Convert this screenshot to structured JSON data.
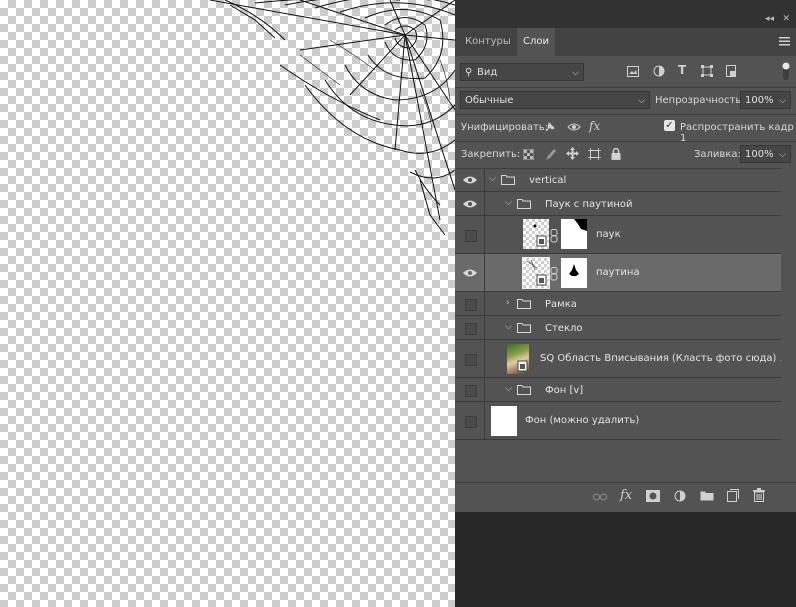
{
  "tabs": [
    {
      "label": "Контуры",
      "active": false
    },
    {
      "label": "Слои",
      "active": true
    }
  ],
  "filter": {
    "kind_label": "Вид"
  },
  "blend": {
    "mode": "Обычные",
    "opacity_label": "Непрозрачность:",
    "opacity_value": "100%"
  },
  "unify": {
    "label": "Унифицировать:",
    "propagate_label": "Распространить кадр 1",
    "propagate_checked": true
  },
  "lock": {
    "label": "Закрепить:",
    "fill_label": "Заливка:",
    "fill_value": "100%"
  },
  "layers": [
    {
      "name": "vertical",
      "type": "group",
      "expanded": true,
      "visible": true,
      "indent": 0
    },
    {
      "name": "Паук с паутиной",
      "type": "group",
      "expanded": true,
      "visible": true,
      "indent": 1
    },
    {
      "name": "паук",
      "type": "smart",
      "visible": false,
      "indent": 2
    },
    {
      "name": "паутина",
      "type": "smart",
      "visible": true,
      "selected": true,
      "indent": 2
    },
    {
      "name": "Рамка",
      "type": "group",
      "expanded": false,
      "visible": false,
      "indent": 1
    },
    {
      "name": "Стекло",
      "type": "group",
      "expanded": true,
      "visible": false,
      "indent": 1
    },
    {
      "name": "SQ Область Вписывания (Класть фото сюда) ...",
      "type": "photo",
      "visible": false,
      "indent": 1
    },
    {
      "name": "Фон [v]",
      "type": "group",
      "expanded": true,
      "visible": false,
      "indent": 1
    },
    {
      "name": "Фон (можно удалить)",
      "type": "fill",
      "visible": false,
      "indent": 0
    }
  ],
  "colors": {
    "panel": "#535353",
    "selected_row": "#6a6a6a",
    "dark": "#282828"
  },
  "icons": [
    "search-icon",
    "image-filter-icon",
    "adjustment-filter-icon",
    "type-filter-icon",
    "shape-filter-icon",
    "smart-object-filter-icon",
    "eye-icon",
    "folder-icon",
    "link-icon",
    "fx-icon",
    "mask-icon",
    "new-group-icon",
    "new-layer-icon",
    "trash-icon"
  ]
}
